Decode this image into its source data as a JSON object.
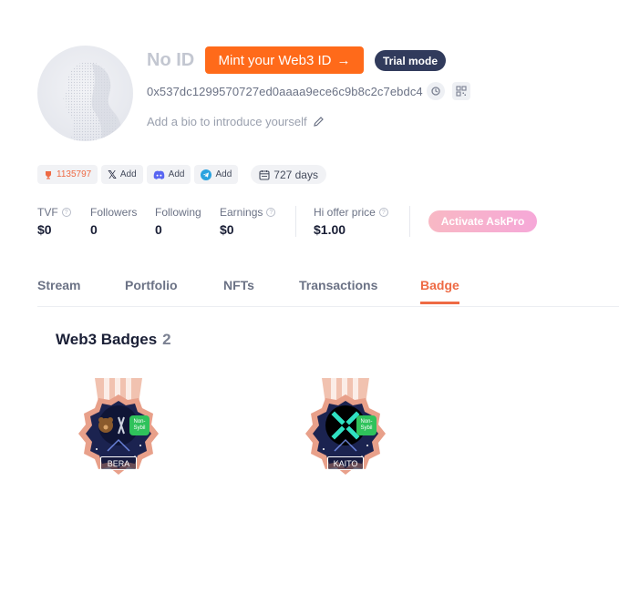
{
  "profile": {
    "name": "No ID",
    "mint_button": "Mint your Web3 ID",
    "mint_arrow": "→",
    "trial_badge": "Trial mode",
    "address": "0x537dc1299570727ed0aaaa9ece6c9b8c2c7ebdc4",
    "bio_placeholder": "Add a bio to introduce yourself"
  },
  "social": {
    "rank": "1135797",
    "x_label": "Add",
    "discord_label": "Add",
    "telegram_label": "Add",
    "days": "727 days"
  },
  "stats": {
    "tvf_label": "TVF",
    "tvf_value": "$0",
    "followers_label": "Followers",
    "followers_value": "0",
    "following_label": "Following",
    "following_value": "0",
    "earnings_label": "Earnings",
    "earnings_value": "$0",
    "hi_offer_label": "Hi offer price",
    "hi_offer_value": "$1.00",
    "askpro_button": "Activate AskPro"
  },
  "tabs": [
    "Stream",
    "Portfolio",
    "NFTs",
    "Transactions",
    "Badge"
  ],
  "active_tab": "Badge",
  "badges_section": {
    "title": "Web3 Badges",
    "count": "2",
    "items": [
      {
        "label": "BERA",
        "tag": "Non-Sybil",
        "icon": "bear-icon"
      },
      {
        "label": "KAITO",
        "tag": "Non-Sybil",
        "icon": "kaito-x-icon"
      }
    ]
  },
  "colors": {
    "accent": "#ff6a1a",
    "active_tab": "#ee6a44",
    "trial_bg": "#313b5c",
    "badge_frame": "#e8a08a",
    "badge_inner": "#1b2350",
    "nonsybil": "#2fc25b"
  }
}
